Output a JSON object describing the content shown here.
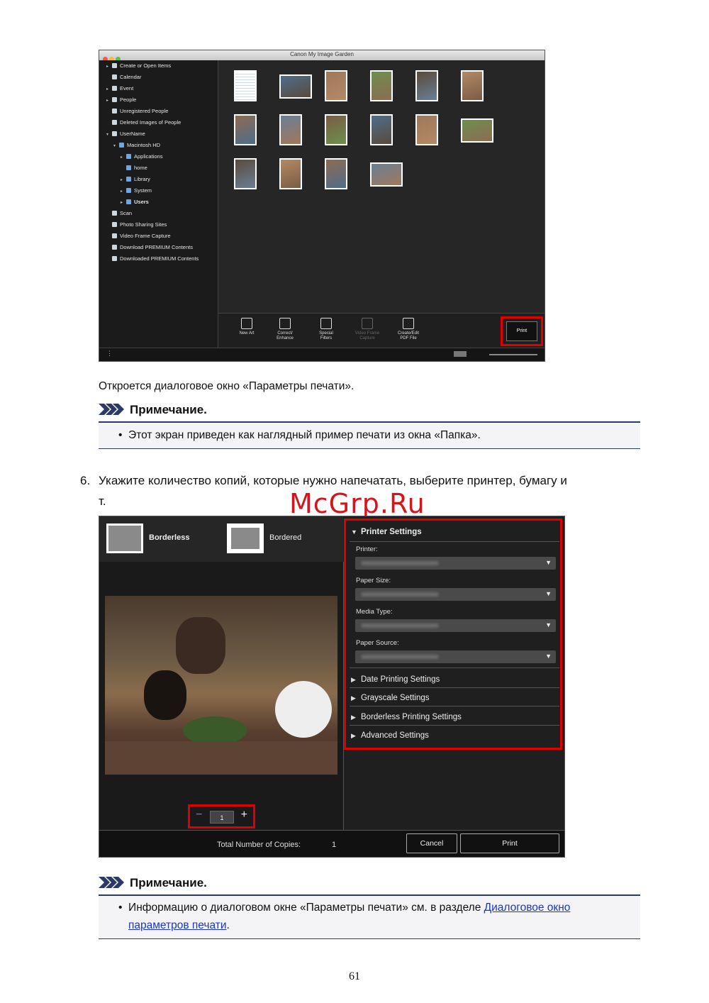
{
  "screenshot1": {
    "window_title": "Canon My Image Garden",
    "sidebar": [
      {
        "label": "Create or Open Items",
        "arrow": "▸",
        "level": 0
      },
      {
        "label": "Calendar",
        "arrow": "",
        "level": 0
      },
      {
        "label": "Event",
        "arrow": "▸",
        "level": 0
      },
      {
        "label": "People",
        "arrow": "▸",
        "level": 0
      },
      {
        "label": "Unregistered People",
        "arrow": "",
        "level": 0
      },
      {
        "label": "Deleted Images of People",
        "arrow": "",
        "level": 0
      },
      {
        "label": "UserName",
        "arrow": "▾",
        "level": 0
      },
      {
        "label": "Macintosh HD",
        "arrow": "▾",
        "level": 1
      },
      {
        "label": "Applications",
        "arrow": "▸",
        "level": 2
      },
      {
        "label": "home",
        "arrow": "",
        "level": 2
      },
      {
        "label": "Library",
        "arrow": "▸",
        "level": 2
      },
      {
        "label": "System",
        "arrow": "▸",
        "level": 2
      },
      {
        "label": "Users",
        "arrow": "▸",
        "level": 2
      },
      {
        "label": "Scan",
        "arrow": "",
        "level": 0
      },
      {
        "label": "Photo Sharing Sites",
        "arrow": "",
        "level": 0
      },
      {
        "label": "Video Frame Capture",
        "arrow": "",
        "level": 0
      },
      {
        "label": "Download PREMIUM Contents",
        "arrow": "",
        "level": 0
      },
      {
        "label": "Downloaded PREMIUM Contents",
        "arrow": "",
        "level": 0
      }
    ],
    "toolbar": {
      "new_art": "New Art",
      "correct": "Correct/\nEnhance",
      "special": "Special\nFilters",
      "video": "Video Frame\nCapture",
      "pdf": "Create/Edit\nPDF File",
      "print": "Print"
    }
  },
  "text": {
    "opens_dialog": "Откроется диалоговое окно «Параметры печати».",
    "note_title_1": "Примечание.",
    "note_1": "Этот экран приведен как наглядный пример печати из окна «Папка».",
    "step_number": "6.",
    "step_line1": "Укажите количество копий, которые нужно напечатать, выберите принтер, бумагу и",
    "step_line2": "т. д.",
    "watermark": "McGrp.Ru",
    "note_title_2": "Примечание.",
    "note_2_prefix": "Информацию о диалоговом окне «Параметры печати» см. в разделе ",
    "note_2_link_line1": "Диалоговое окно",
    "note_2_link_line2": "параметров печати",
    "note_2_suffix": ".",
    "page_number": "61"
  },
  "screenshot2": {
    "layouts": {
      "borderless": "Borderless",
      "bordered": "Bordered"
    },
    "printer_settings": "Printer Settings",
    "fields": {
      "printer": "Printer:",
      "paper_size": "Paper Size:",
      "media_type": "Media Type:",
      "paper_source": "Paper Source:"
    },
    "sections": {
      "date": "Date Printing Settings",
      "grayscale": "Grayscale Settings",
      "borderless": "Borderless Printing Settings",
      "advanced": "Advanced Settings"
    },
    "copies": {
      "minus": "−",
      "value": "1",
      "plus": "+"
    },
    "total_label": "Total Number of Copies:",
    "total_value": "1",
    "cancel": "Cancel",
    "print": "Print"
  },
  "colors": {
    "highlight": "#e00000",
    "link": "#1a36d1",
    "note_rule": "#2b3a67"
  }
}
